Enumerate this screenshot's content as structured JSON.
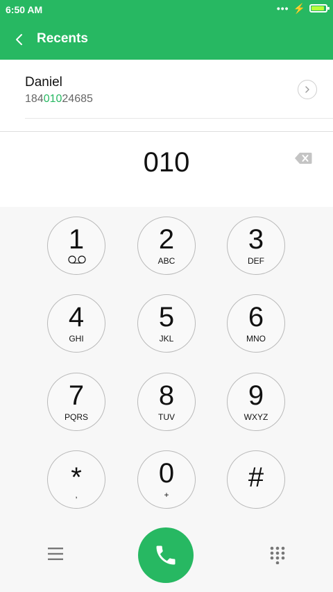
{
  "status": {
    "time": "6:50 AM",
    "dots": "•••",
    "bolt": "⚡",
    "battery_level": 1.0
  },
  "header": {
    "title": "Recents"
  },
  "contact": {
    "name": "Daniel",
    "number_prefix": "184",
    "number_match": "010",
    "number_suffix": "24685"
  },
  "dialed": "010",
  "keys": [
    {
      "digit": "1",
      "letters": ""
    },
    {
      "digit": "2",
      "letters": "ABC"
    },
    {
      "digit": "3",
      "letters": "DEF"
    },
    {
      "digit": "4",
      "letters": "GHI"
    },
    {
      "digit": "5",
      "letters": "JKL"
    },
    {
      "digit": "6",
      "letters": "MNO"
    },
    {
      "digit": "7",
      "letters": "PQRS"
    },
    {
      "digit": "8",
      "letters": "TUV"
    },
    {
      "digit": "9",
      "letters": "WXYZ"
    },
    {
      "digit": "*",
      "letters": ","
    },
    {
      "digit": "0",
      "letters": "+"
    },
    {
      "digit": "#",
      "letters": ""
    }
  ],
  "colors": {
    "accent": "#27b862"
  },
  "icons": {
    "back": "chevron-left-icon",
    "voicemail": "voicemail-icon",
    "delete": "backspace-icon",
    "menu": "menu-icon",
    "call": "phone-icon",
    "dialpad": "dialpad-icon"
  }
}
